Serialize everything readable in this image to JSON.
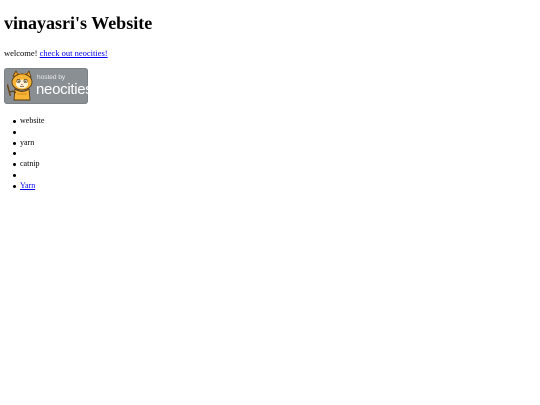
{
  "page": {
    "title": "vinayasri's Website",
    "welcome_text": "welcome! ",
    "welcome_link": "check out neocities!"
  },
  "badge": {
    "hosted_by": "hosted by",
    "name": "neocities",
    "background_color": "#8a8f93",
    "icon": "neocities-cat-icon"
  },
  "list": {
    "items": [
      {
        "label": "website",
        "link": false
      },
      {
        "label": "",
        "link": false
      },
      {
        "label": "yarn",
        "link": false
      },
      {
        "label": "",
        "link": false
      },
      {
        "label": "catnip",
        "link": false
      },
      {
        "label": "",
        "link": false
      },
      {
        "label": "Yarn",
        "link": true
      }
    ]
  },
  "colors": {
    "link": "#0000ee",
    "text": "#000000",
    "background": "#ffffff"
  }
}
